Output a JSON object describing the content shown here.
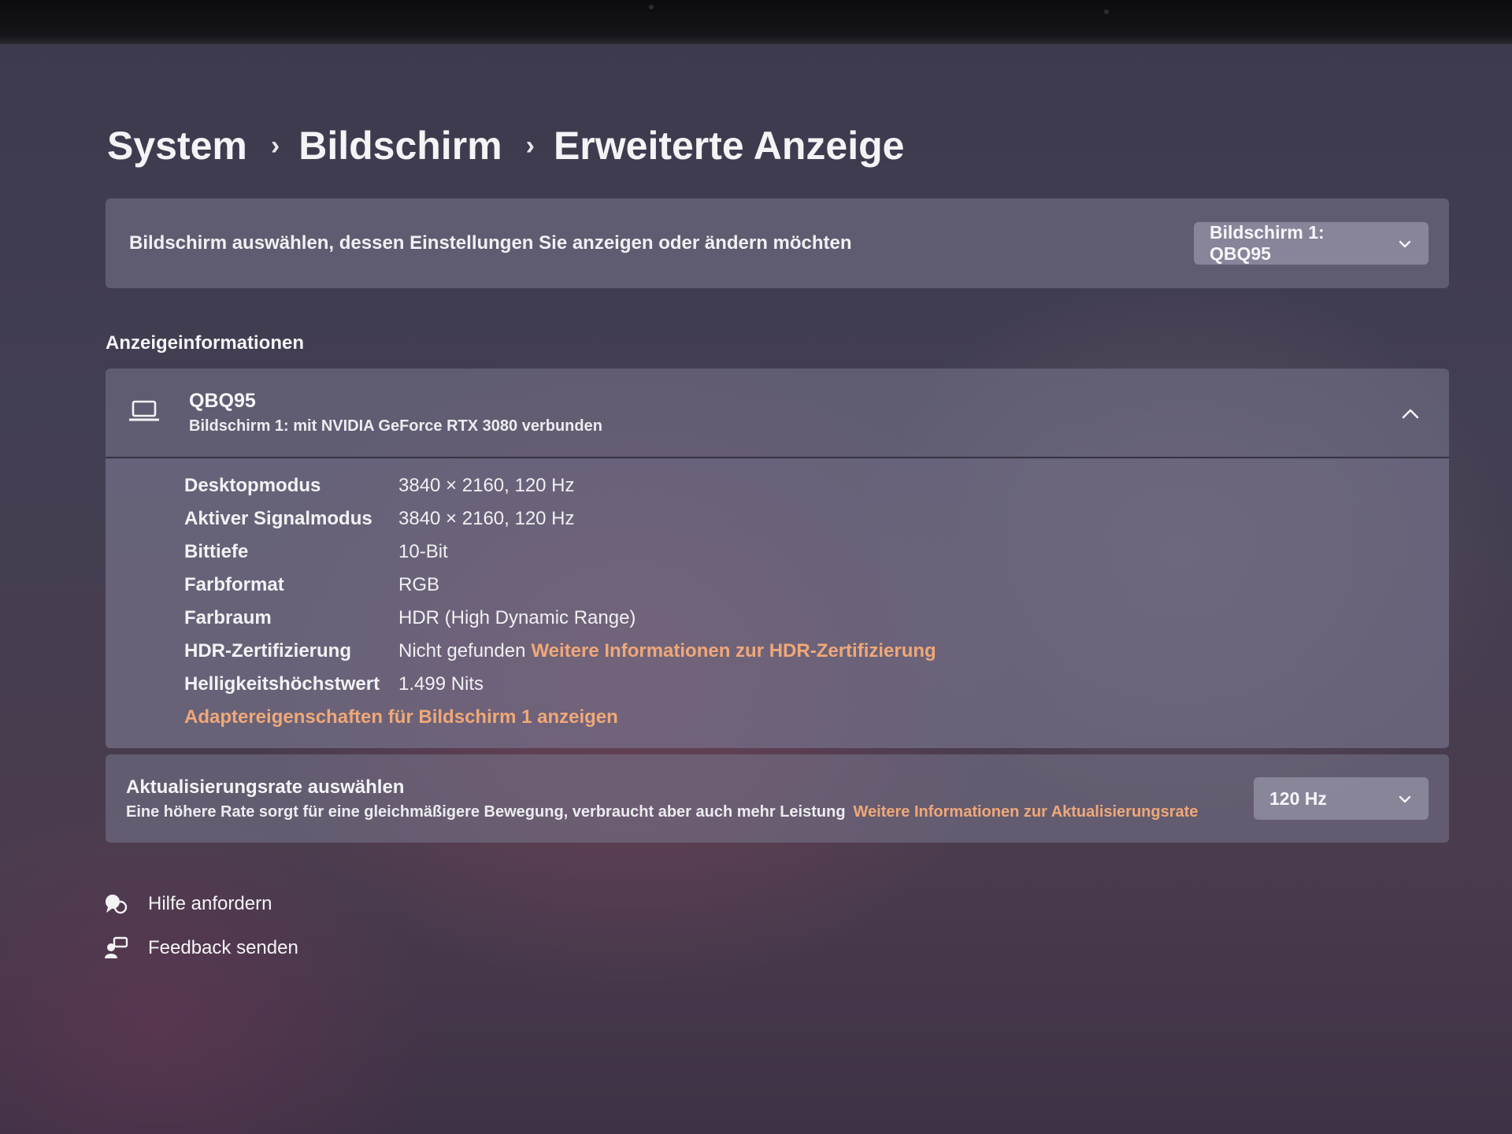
{
  "breadcrumb": {
    "items": [
      "System",
      "Bildschirm",
      "Erweiterte Anzeige"
    ],
    "separator": "›"
  },
  "display_select": {
    "label": "Bildschirm auswählen, dessen Einstellungen Sie anzeigen oder ändern möchten",
    "selected": "Bildschirm 1: QBQ95",
    "chevron_icon": "chevron-down-icon"
  },
  "display_info": {
    "section_title": "Anzeigeinformationen",
    "monitor_name": "QBQ95",
    "monitor_subtitle": "Bildschirm 1: mit NVIDIA GeForce RTX 3080 verbunden",
    "monitor_icon": "laptop-icon",
    "collapse_icon": "chevron-up-icon",
    "rows": [
      {
        "key": "Desktopmodus",
        "value": "3840 × 2160, 120 Hz"
      },
      {
        "key": "Aktiver Signalmodus",
        "value": "3840 × 2160, 120 Hz"
      },
      {
        "key": "Bittiefe",
        "value": "10-Bit"
      },
      {
        "key": "Farbformat",
        "value": "RGB"
      },
      {
        "key": "Farbraum",
        "value": "HDR (High Dynamic Range)"
      },
      {
        "key": "HDR-Zertifizierung",
        "value": "Nicht gefunden",
        "link": "Weitere Informationen zur HDR-Zertifizierung"
      },
      {
        "key": "Helligkeitshöchstwert",
        "value": "1.499 Nits"
      }
    ],
    "adapter_link": "Adaptereigenschaften für Bildschirm 1 anzeigen"
  },
  "refresh_rate": {
    "title": "Aktualisierungsrate auswählen",
    "description": "Eine höhere Rate sorgt für eine gleichmäßigere Bewegung, verbraucht aber auch mehr Leistung",
    "link": "Weitere Informationen zur Aktualisierungsrate",
    "selected": "120 Hz"
  },
  "footer": {
    "help": "Hilfe anfordern",
    "feedback": "Feedback senden"
  },
  "colors": {
    "link": "#f0a878",
    "card": "#78768c"
  }
}
